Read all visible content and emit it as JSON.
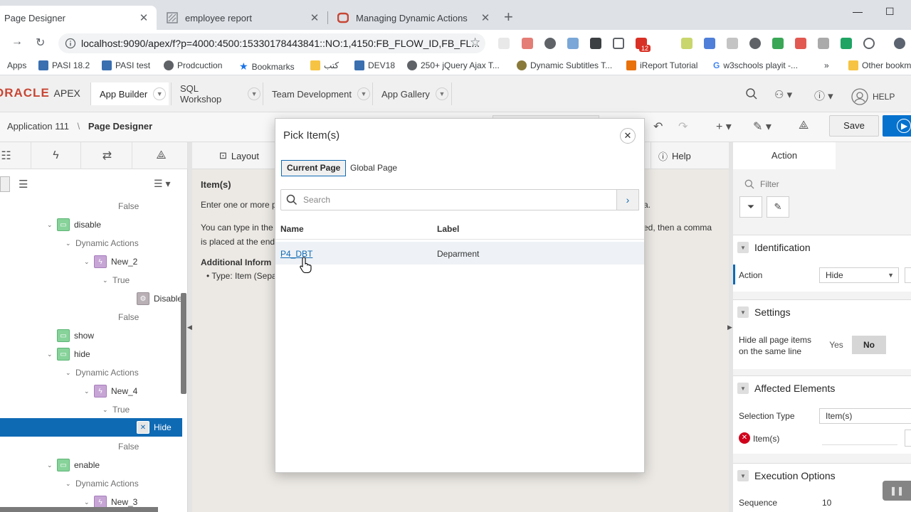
{
  "browser": {
    "tabs": [
      {
        "title": "Page Designer"
      },
      {
        "title": "employee report"
      },
      {
        "title": "Managing Dynamic Actions"
      }
    ],
    "url": "localhost:9090/apex/f?p=4000:4500:15330178443841::NO:1,4150:FB_FLOW_ID,FB_FL...",
    "extension_badge": "12",
    "bookmarks": [
      {
        "label": "Apps"
      },
      {
        "label": "PASI 18.2"
      },
      {
        "label": "PASI test"
      },
      {
        "label": "Prodcuction"
      },
      {
        "label": "Bookmarks"
      },
      {
        "label": "كتب"
      },
      {
        "label": "DEV18"
      },
      {
        "label": "250+ jQuery Ajax T..."
      },
      {
        "label": "Dynamic Subtitles T..."
      },
      {
        "label": "iReport Tutorial"
      },
      {
        "label": "w3schools playit -..."
      },
      {
        "label": "Other bookm"
      }
    ]
  },
  "apex": {
    "logo_oracle": "ORACLE",
    "logo_apex": "APEX",
    "menus": [
      {
        "label": "App Builder"
      },
      {
        "label": "SQL Workshop"
      },
      {
        "label": "Team Development"
      },
      {
        "label": "App Gallery"
      }
    ],
    "help_label": "HELP",
    "breadcrumb": {
      "app": "Application 111",
      "sep": "\\",
      "page": "Page Designer"
    },
    "save_label": "Save"
  },
  "left_tree": {
    "nodes": [
      {
        "label": "False"
      },
      {
        "label": "disable"
      },
      {
        "label": "Dynamic Actions"
      },
      {
        "label": "New_2"
      },
      {
        "label": "True"
      },
      {
        "label": "Disable"
      },
      {
        "label": "False"
      },
      {
        "label": "show"
      },
      {
        "label": "hide"
      },
      {
        "label": "Dynamic Actions"
      },
      {
        "label": "New_4"
      },
      {
        "label": "True"
      },
      {
        "label": "Hide"
      },
      {
        "label": "False"
      },
      {
        "label": "enable"
      },
      {
        "label": "Dynamic Actions"
      },
      {
        "label": "New_3"
      }
    ]
  },
  "center": {
    "tab_layout": "Layout",
    "tab_help": "Help",
    "heading": "Item(s)",
    "para1": "Enter one or more p",
    "para1_tail": "a.",
    "para2a": "You can type in the",
    "para2a_tail": "ed, then a comma",
    "para2b": "is placed at the end",
    "additional": "Additional Inform",
    "bullet": "Type: Item (Sepa"
  },
  "right": {
    "tab_action": "Action",
    "filter_placeholder": "Filter",
    "identification": {
      "title": "Identification",
      "action_label": "Action",
      "action_value": "Hide"
    },
    "settings": {
      "title": "Settings",
      "hide_label_1": "Hide all page items",
      "hide_label_2": "on the same line",
      "yes": "Yes",
      "no": "No"
    },
    "affected": {
      "title": "Affected Elements",
      "selection_type_label": "Selection Type",
      "selection_type_value": "Item(s)",
      "items_label": "Item(s)"
    },
    "execution": {
      "title": "Execution Options",
      "sequence_label": "Sequence",
      "sequence_value": "10"
    }
  },
  "modal": {
    "title": "Pick Item(s)",
    "tab_current": "Current Page",
    "tab_global": "Global Page",
    "search_placeholder": "Search",
    "col_name": "Name",
    "col_label": "Label",
    "rows": [
      {
        "name": "P4_DBT",
        "label": "Deparment"
      }
    ]
  }
}
